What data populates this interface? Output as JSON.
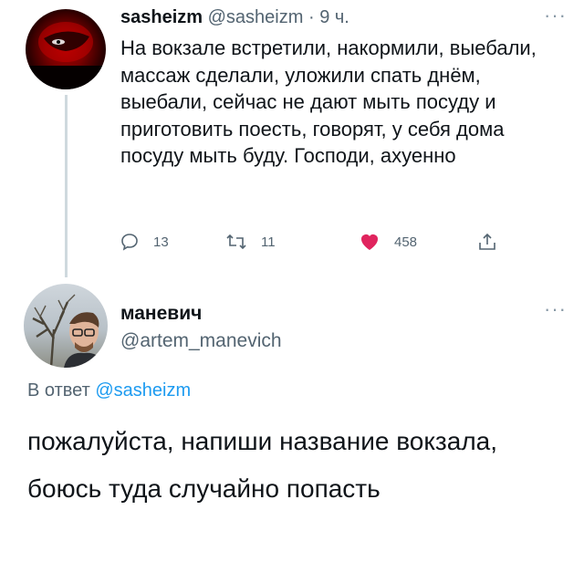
{
  "tweet1": {
    "name": "sasheizm",
    "handle": "@sasheizm",
    "separator": " · ",
    "time": "9 ч.",
    "more": "···",
    "text": "На вокзале встретили, накормили, выебали, массаж сделали, уложили спать днём, выебали, сейчас не дают мыть посуду и приготовить поесть, говорят, у себя дома посуду мыть буду. Господи, ахуенно",
    "actions": {
      "replies": "13",
      "retweets": "11",
      "likes": "458"
    },
    "icons": [
      "reply-icon",
      "retweet-icon",
      "heart-icon",
      "share-icon"
    ],
    "colors": {
      "like": "#e0245e",
      "muted": "#536471"
    }
  },
  "tweet2": {
    "name": "маневич",
    "handle": "@artem_manevich",
    "more": "···",
    "reply_prefix": "В ответ ",
    "reply_to": "@sasheizm",
    "text": "пожалуйста, напиши название вокзала, боюсь туда случайно попасть",
    "colors": {
      "link": "#1d9bf0"
    }
  }
}
